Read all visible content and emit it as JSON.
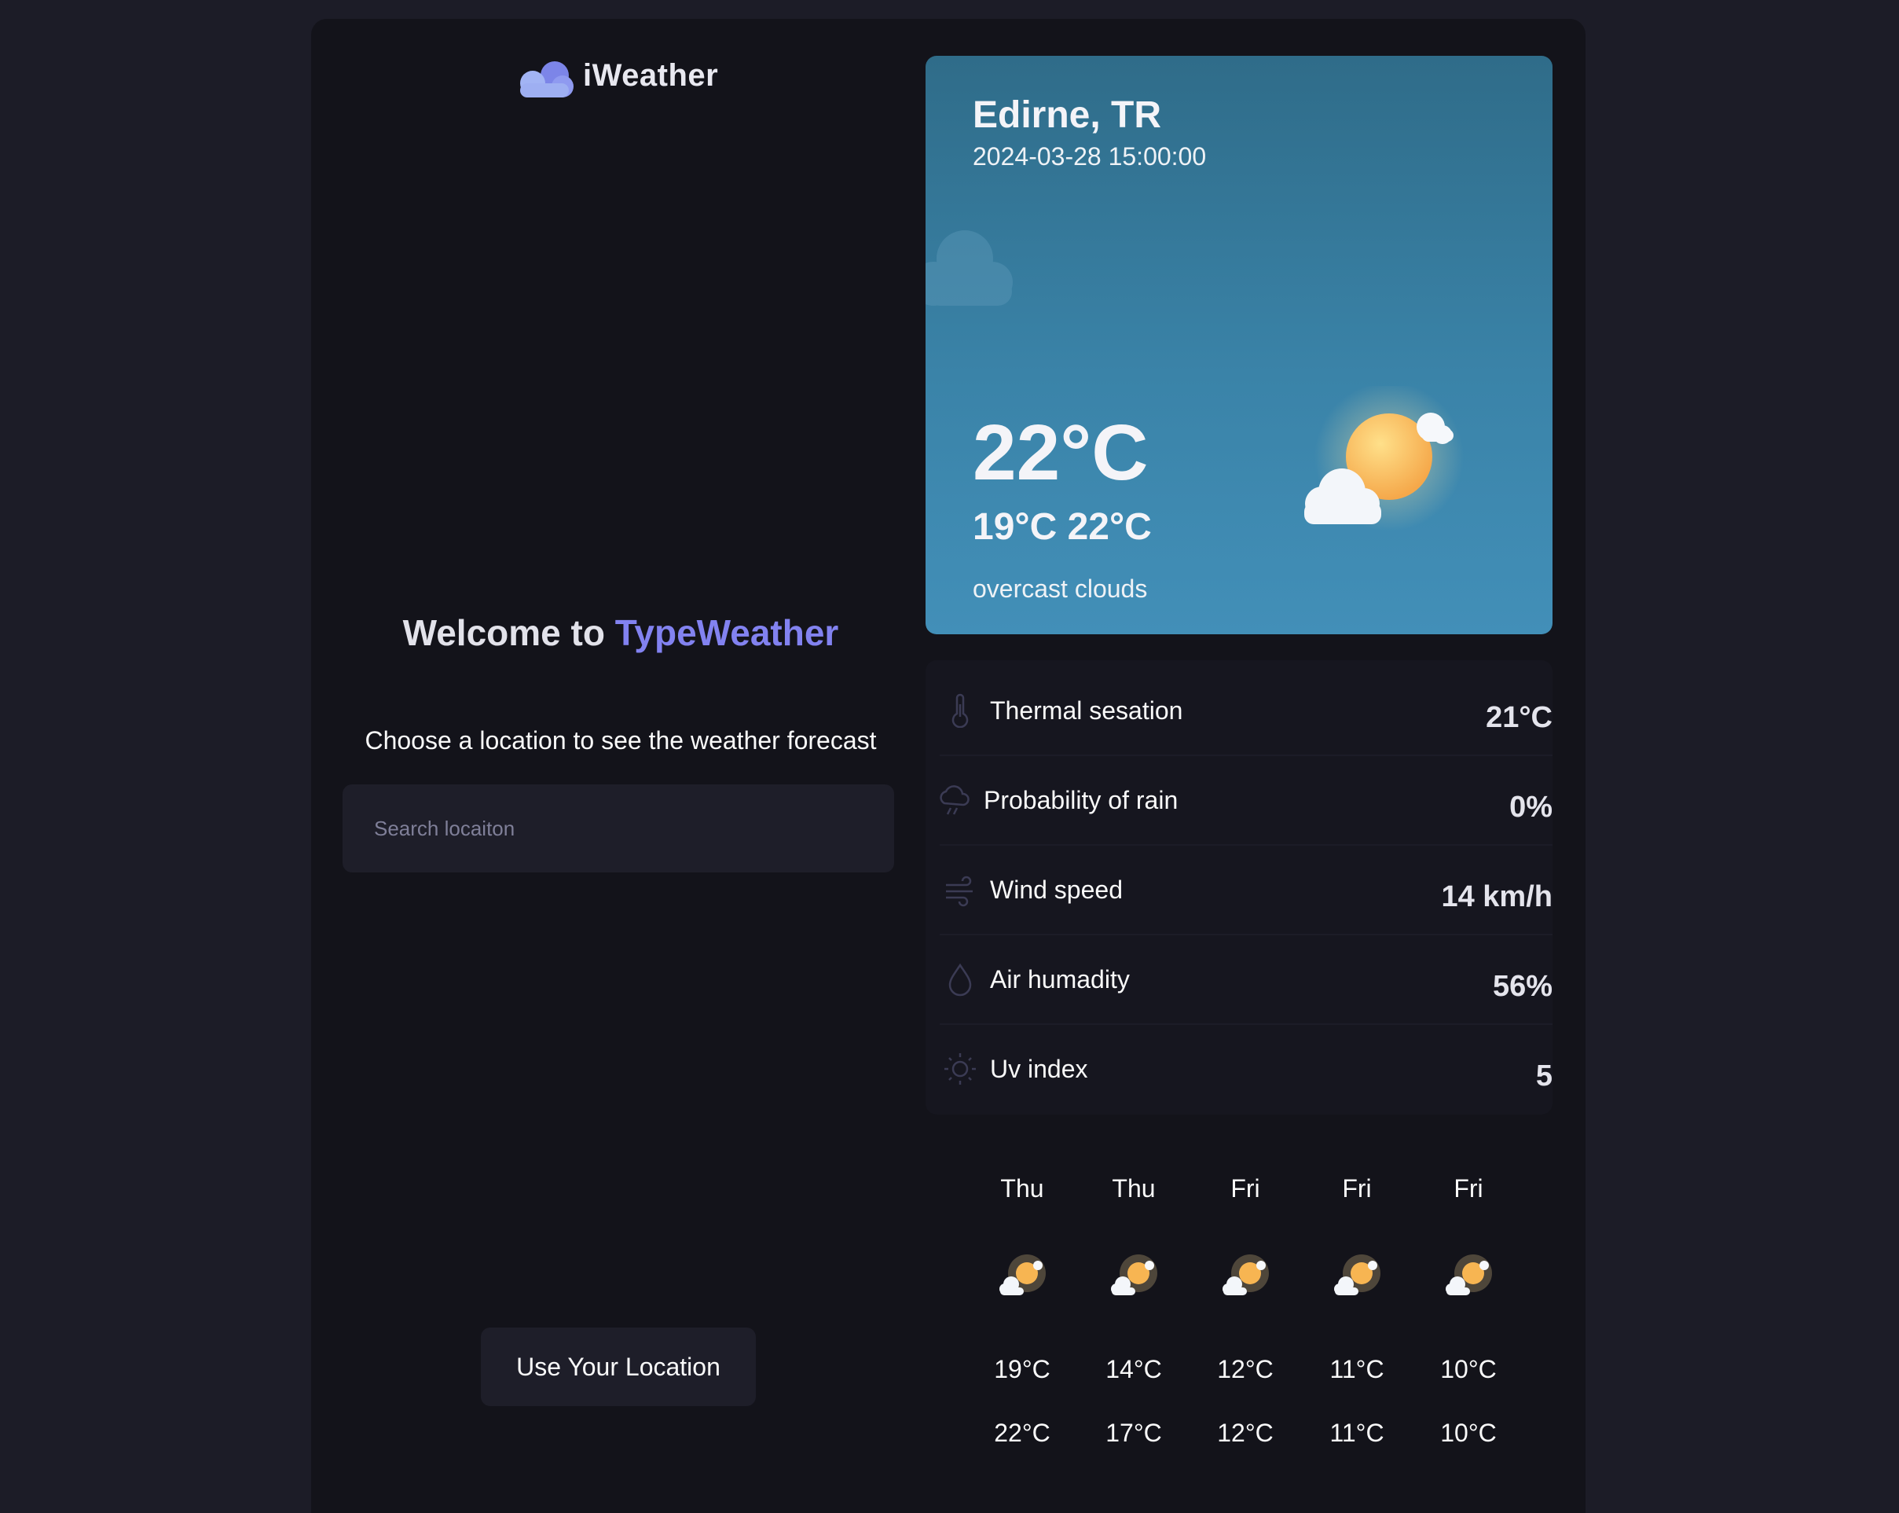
{
  "brand": {
    "name": "iWeather",
    "icon": "cloud-logo-icon"
  },
  "welcome": {
    "prefix": "Welcome to ",
    "accent": "TypeWeather"
  },
  "subtitle": "Choose a location to see the weather forecast",
  "search": {
    "placeholder": "Search locaiton",
    "value": ""
  },
  "location_button": "Use Your Location",
  "current": {
    "city": "Edirne, TR",
    "datetime": "2024-03-28 15:00:00",
    "temp": "22°C",
    "range": "19°C 22°C",
    "description": "overcast clouds",
    "icon": "sun-cloud-icon"
  },
  "details": [
    {
      "icon": "thermometer-icon",
      "label": "Thermal sesation",
      "value": "21°C"
    },
    {
      "icon": "rain-cloud-icon",
      "label": "Probability of rain",
      "value": "0%"
    },
    {
      "icon": "wind-icon",
      "label": "Wind speed",
      "value": "14 km/h"
    },
    {
      "icon": "drop-icon",
      "label": "Air humadity",
      "value": "56%"
    },
    {
      "icon": "sun-icon",
      "label": "Uv index",
      "value": "5"
    }
  ],
  "forecast": [
    {
      "day": "Thu",
      "max": "19°C",
      "min": "22°C",
      "icon": "sun-cloud-icon"
    },
    {
      "day": "Thu",
      "max": "14°C",
      "min": "17°C",
      "icon": "sun-cloud-icon"
    },
    {
      "day": "Fri",
      "max": "12°C",
      "min": "12°C",
      "icon": "sun-cloud-icon"
    },
    {
      "day": "Fri",
      "max": "11°C",
      "min": "11°C",
      "icon": "sun-cloud-icon"
    },
    {
      "day": "Fri",
      "max": "10°C",
      "min": "10°C",
      "icon": "sun-cloud-icon"
    }
  ],
  "colors": {
    "accent": "#8282f0",
    "background": "#13131a",
    "card": "#1e1e29",
    "hero_top": "#2f6c89",
    "hero_bottom": "#428fb8"
  }
}
